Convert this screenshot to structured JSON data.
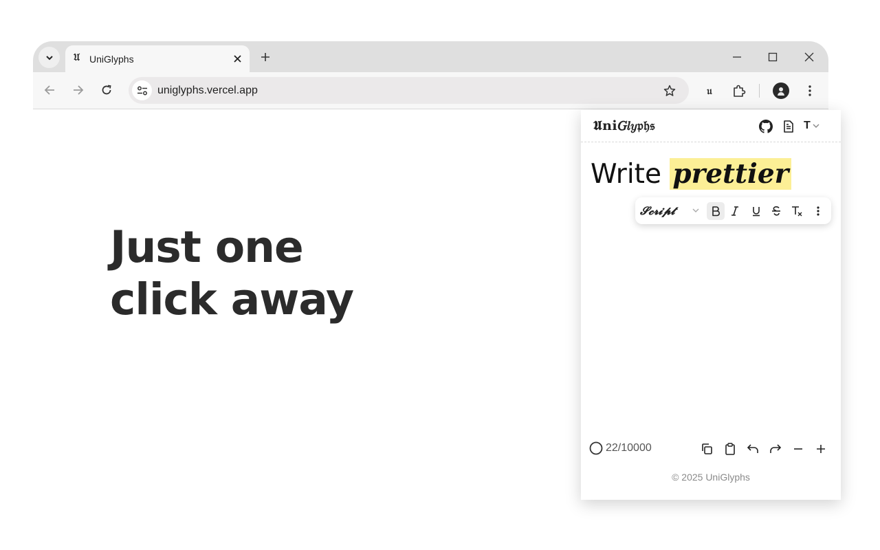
{
  "browser": {
    "tab": {
      "favicon": "𝔘",
      "title": "UniGlyphs"
    },
    "url": "uniglyphs.vercel.app",
    "extension_icon_glyph": "𝔲"
  },
  "hero": {
    "line1": "Just one",
    "line2": "click away"
  },
  "popup": {
    "logo": "𝖀𝐧𝐢𝐺𝑙𝑦𝔭𝔥𝔰",
    "font_selector": "T",
    "editor": {
      "plain": "Write ",
      "styled": "𝒑𝒓𝒆𝒕𝒕𝒊𝒆𝒓"
    },
    "format_bar": {
      "style_name": "𝓢𝓬𝓻𝓲𝓹𝓽",
      "active": "bold"
    },
    "counter": "22/10000",
    "copyright": "© 2025 UniGlyphs"
  },
  "colors": {
    "highlight": "#fcef96",
    "headline": "#2b2b2b"
  }
}
